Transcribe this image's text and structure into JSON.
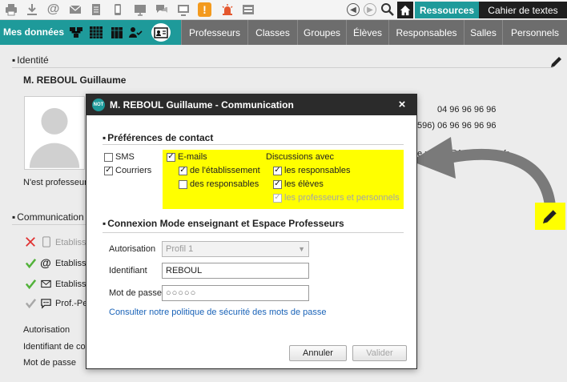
{
  "app": {
    "colors": {
      "accent": "#1e9a9a",
      "dark": "#1e1e1e",
      "highlight": "#ffff00",
      "alert": "#f39a1e"
    }
  },
  "topbar": {
    "icons": [
      "print-icon",
      "download-icon",
      "at-icon",
      "mail-icon",
      "document-icon",
      "mobile-icon",
      "presentation-icon",
      "chat-icon",
      "screen-icon",
      "alert-icon",
      "siren-icon",
      "form-icon"
    ],
    "alert_glyph": "!",
    "tabs": {
      "ressources": "Ressources",
      "cahier": "Cahier de textes"
    }
  },
  "navbar": {
    "mes_donnees": "Mes données",
    "tabs": [
      "Professeurs",
      "Classes",
      "Groupes",
      "Élèves",
      "Responsables",
      "Salles",
      "Personnels"
    ]
  },
  "page": {
    "identite_title": "Identité",
    "person_name": "M. REBOUL Guillaume",
    "phone_1": "04 96 96 96 96",
    "phone_2": "596) 06 96 96 96 96",
    "email": "e.reboul@fournisseur.fr",
    "nest_text": "N'est professeur",
    "communication_title": "Communication",
    "comm_rows": [
      "Etabliss",
      "Etabliss",
      "Etabliss",
      "Prof.-Pe"
    ],
    "autorisation": "Autorisation",
    "identifiant": "Identifiant de co",
    "mot_de_passe": "Mot de passe"
  },
  "modal": {
    "badge": "NOT",
    "title": "M. REBOUL Guillaume - Communication",
    "close": "×",
    "prefs_title": "Préférences de contact",
    "sms": "SMS",
    "courriers": "Courriers",
    "emails": "E-mails",
    "de_etab": "de l'établissement",
    "des_resp": "des responsables",
    "discussions": "Discussions avec",
    "les_resp": "les responsables",
    "les_eleves": "les élèves",
    "les_profs": "les professeurs et personnels",
    "connexion_title": "Connexion Mode enseignant et Espace Professeurs",
    "autorisation_label": "Autorisation",
    "autorisation_value": "Profil 1",
    "identifiant_label": "Identifiant",
    "identifiant_value": "REBOUL",
    "mdp_label": "Mot de passe",
    "mdp_value": "○○○○○",
    "policy_link": "Consulter notre politique de sécurité des mots de passe",
    "annuler": "Annuler",
    "valider": "Valider",
    "checks": {
      "sms": false,
      "courriers": true,
      "emails": true,
      "de_etab": true,
      "des_resp": false,
      "les_resp": true,
      "les_eleves": true,
      "les_profs": true
    }
  }
}
